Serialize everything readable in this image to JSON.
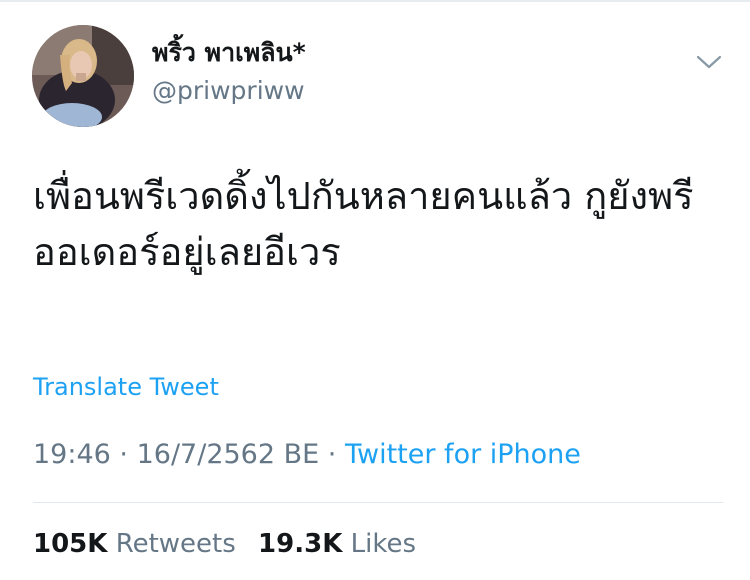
{
  "user": {
    "display_name": "พริ้ว พาเพลิน*",
    "handle": "@priwpriww",
    "avatar_icon": "profile-photo"
  },
  "menu": {
    "icon": "chevron-down-icon"
  },
  "tweet": {
    "text": "เพื่อนพรีเวดดิ้งไปกันหลายคนแล้ว กูยังพรีออเดอร์อยู่เลยอีเวร",
    "translate_label": "Translate Tweet",
    "time": "19:46",
    "separator": "·",
    "date": "16/7/2562 BE",
    "source": "Twitter for iPhone"
  },
  "stats": {
    "retweets_count": "105K",
    "retweets_label": "Retweets",
    "likes_count": "19.3K",
    "likes_label": "Likes"
  },
  "colors": {
    "link": "#1da1f2",
    "secondary_text": "#657786",
    "primary_text": "#14171a",
    "divider": "#e1e8ed"
  }
}
